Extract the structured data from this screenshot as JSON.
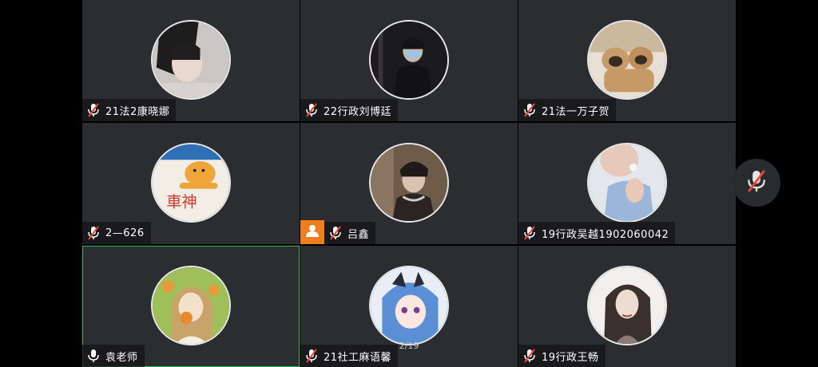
{
  "participants": [
    {
      "name": "21法2康晓娜",
      "muted": true
    },
    {
      "name": "22行政刘博廷",
      "muted": true
    },
    {
      "name": "21法一万子贺",
      "muted": true
    },
    {
      "name": "2—626",
      "muted": true
    },
    {
      "name": "吕鑫",
      "muted": true,
      "host": true
    },
    {
      "name": "19行政吴越1902060042",
      "muted": true
    },
    {
      "name": "袁老师",
      "muted": false,
      "active": true
    },
    {
      "name": "21社工麻语馨",
      "muted": true
    },
    {
      "name": "19行政王畅",
      "muted": true
    }
  ],
  "page_indicator": "2/19",
  "icons": {
    "mic_muted": "mic-muted-icon",
    "mic_on": "mic-icon",
    "host": "person-icon"
  },
  "colors": {
    "tile_bg": "#2c2d30",
    "muted_red": "#e8473c",
    "active_border": "#2fbf4f",
    "host_badge": "#f07d1e"
  }
}
